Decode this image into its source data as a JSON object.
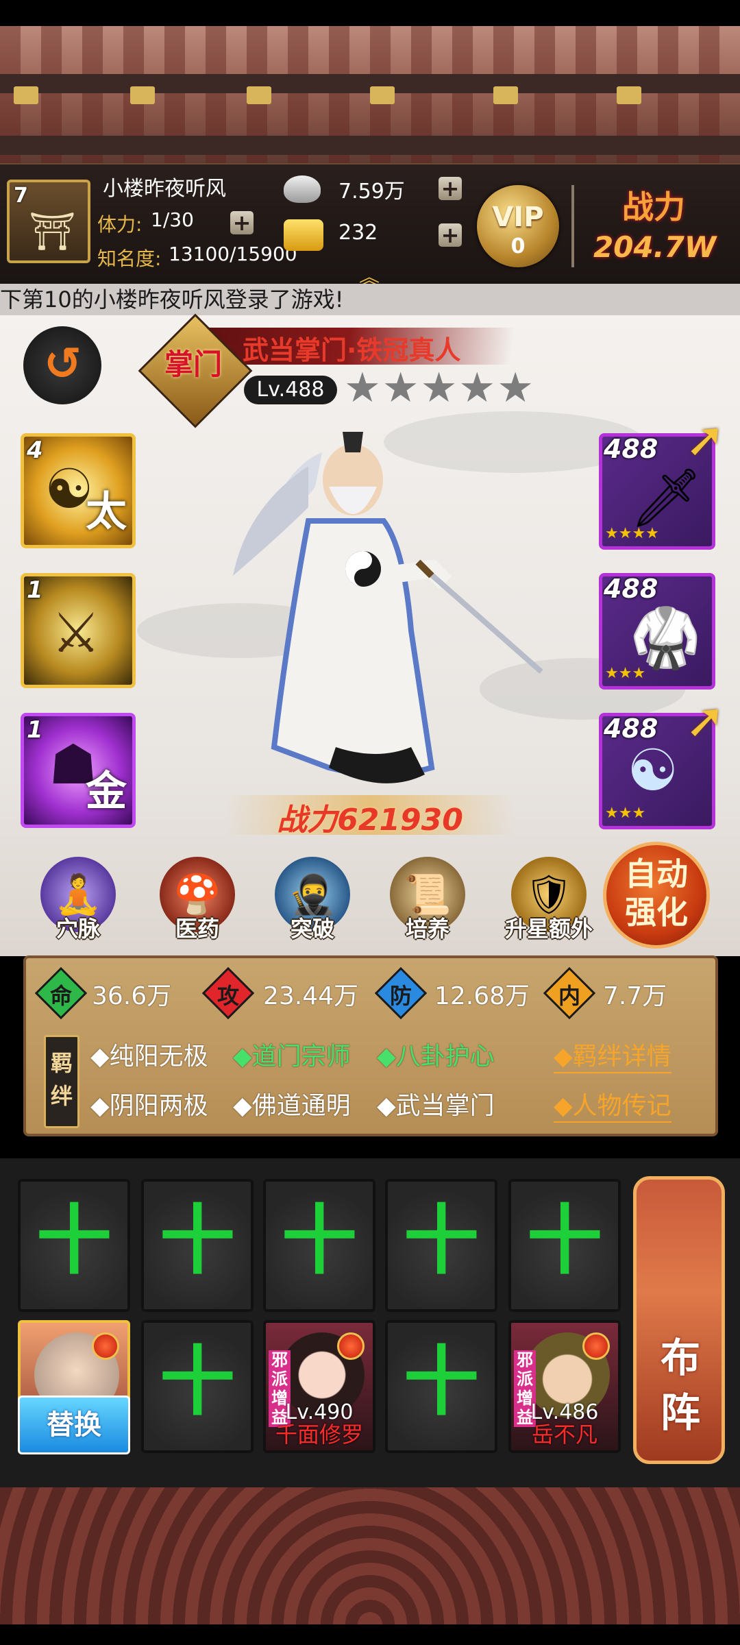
{
  "player": {
    "level": "7",
    "name": "小楼昨夜听风",
    "stamina_label": "体力:",
    "stamina_value": "1/30",
    "fame_label": "知名度:",
    "fame_value": "13100/15900",
    "silver": "7.59万",
    "gold": "232",
    "vip_label": "VIP",
    "vip_level": "0",
    "power_label": "战力",
    "power_value": "204.7W"
  },
  "ticker": "下第10的小楼昨夜听风登录了游戏!",
  "hero": {
    "badge": "掌门",
    "name": "武当掌门·铁冠真人",
    "level": "Lv.488",
    "stars_total": 5,
    "stars_filled": 0,
    "power": "战力621930"
  },
  "skills": [
    {
      "count": "4",
      "glyph": "太",
      "color": "gold"
    },
    {
      "count": "1",
      "glyph": "",
      "color": "gold"
    },
    {
      "count": "1",
      "glyph": "金",
      "color": "purple"
    }
  ],
  "equipment": [
    {
      "level": "488",
      "stars": 4,
      "icon": "sword-icon",
      "upgradable": true
    },
    {
      "level": "488",
      "stars": 3,
      "icon": "armor-icon",
      "upgradable": false
    },
    {
      "level": "488",
      "stars": 3,
      "icon": "bagua-icon",
      "upgradable": true
    }
  ],
  "actions": [
    {
      "label": "穴脉",
      "icon": "meridian-icon"
    },
    {
      "label": "医药",
      "icon": "medicine-icon"
    },
    {
      "label": "突破",
      "icon": "breakthrough-icon"
    },
    {
      "label": "培养",
      "icon": "cultivate-icon"
    },
    {
      "label": "升星额外",
      "icon": "star-up-icon"
    }
  ],
  "auto_button": "自动强化",
  "stats": [
    {
      "label": "命",
      "value": "36.6万",
      "color": "#2fb84a"
    },
    {
      "label": "攻",
      "value": "23.44万",
      "color": "#e0262a"
    },
    {
      "label": "防",
      "value": "12.68万",
      "color": "#2a8ae0"
    },
    {
      "label": "内",
      "value": "7.7万",
      "color": "#f0a020"
    }
  ],
  "bond_tag": "羁绊",
  "bonds_row1": [
    {
      "text": "◆纯阳无极",
      "active": false
    },
    {
      "text": "◆道门宗师",
      "active": true
    },
    {
      "text": "◆八卦护心",
      "active": true
    }
  ],
  "bonds_row2": [
    {
      "text": "◆阴阳两极",
      "active": false
    },
    {
      "text": "◆佛道通明",
      "active": false
    },
    {
      "text": "◆武当掌门",
      "active": false
    }
  ],
  "links": {
    "bond_details": "◆羁绊详情",
    "biography": "◆人物传记"
  },
  "team": {
    "plus_symbol": "十",
    "swap_label": "替换",
    "members": [
      {
        "level": "Lv.490",
        "name": "千面修罗",
        "tag": "邪派增益"
      },
      {
        "level": "Lv.486",
        "name": "岳不凡",
        "tag": "邪派增益"
      }
    ],
    "formation_label": "布阵"
  }
}
